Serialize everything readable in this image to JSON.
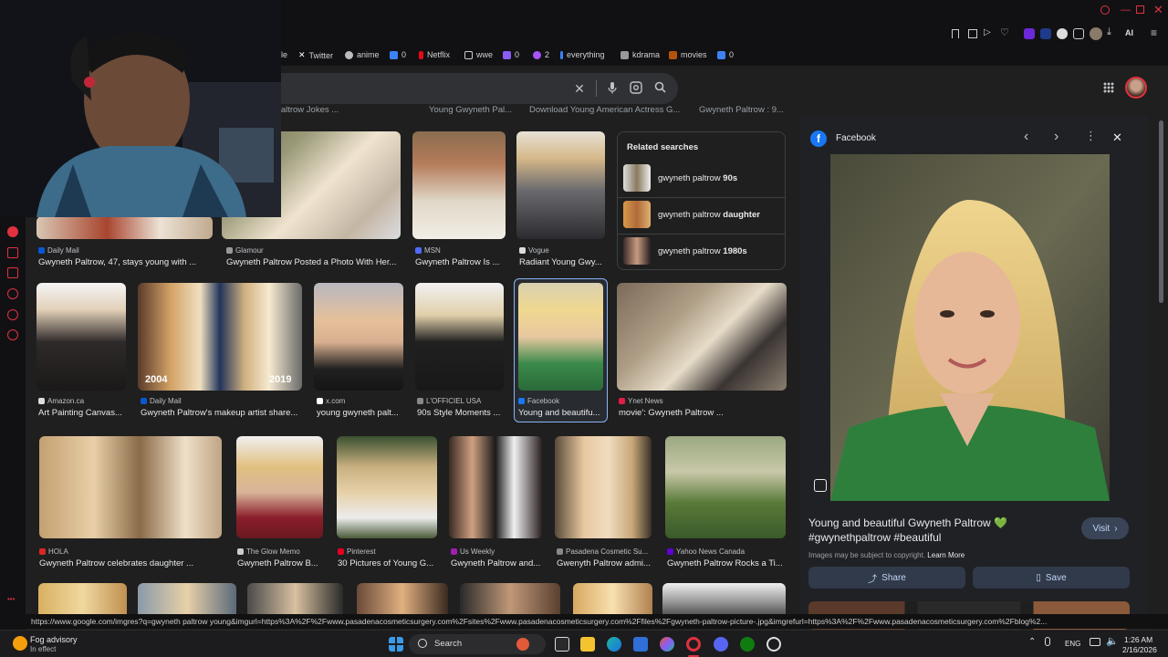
{
  "bookmarks": [
    {
      "label": "le",
      "color": "#888"
    },
    {
      "label": "Twitter",
      "color": "#ffffff"
    },
    {
      "label": "anime",
      "color": "#cccccc"
    },
    {
      "label": "0",
      "color": "#3b82f6"
    },
    {
      "label": "Netflix",
      "color": "#e50914"
    },
    {
      "label": "wwe",
      "color": "#cccccc"
    },
    {
      "label": "0",
      "color": "#8b5cf6"
    },
    {
      "label": "2",
      "color": "#a855f7"
    },
    {
      "label": "everything",
      "color": "#3b82f6"
    },
    {
      "label": "kdrama",
      "color": "#cccccc"
    },
    {
      "label": "movies",
      "color": "#b45309"
    },
    {
      "label": "0",
      "color": "#3b82f6"
    }
  ],
  "top_row_titles": [
    "...th Paltrow Jokes ...",
    "Young Gwyneth Pal...",
    "Download Young American Actress G...",
    "Gwyneth Paltrow : 9..."
  ],
  "row1": [
    {
      "source": "Daily Mail",
      "title": "Gwyneth Paltrow, 47, stays young with ...",
      "fav": "#0b57d0"
    },
    {
      "source": "Glamour",
      "title": "Gwyneth Paltrow Posted a Photo With Her...",
      "fav": "#999999"
    },
    {
      "source": "MSN",
      "title": "Gwyneth Paltrow Is ...",
      "fav": "#4d6bfe"
    },
    {
      "source": "Vogue",
      "title": "Radiant Young Gwy...",
      "fav": "#dddddd"
    }
  ],
  "related": {
    "heading": "Related searches",
    "items": [
      {
        "prefix": "gwyneth paltrow ",
        "bold": "90s"
      },
      {
        "prefix": "gwyneth paltrow ",
        "bold": "daughter"
      },
      {
        "prefix": "gwyneth paltrow ",
        "bold": "1980s"
      }
    ]
  },
  "row2": [
    {
      "source": "Amazon.ca",
      "title": "Art Painting Canvas...",
      "fav": "#dddddd"
    },
    {
      "source": "Daily Mail",
      "title": "Gwyneth Paltrow's makeup artist share...",
      "fav": "#0b57d0"
    },
    {
      "source": "x.com",
      "title": "young gwyneth palt...",
      "fav": "#ffffff"
    },
    {
      "source": "L'OFFICIEL USA",
      "title": "90s Style Moments ...",
      "fav": "#888888"
    },
    {
      "source": "Facebook",
      "title": "Young and beautifu...",
      "fav": "#1877f2"
    },
    {
      "source": "Ynet News",
      "title": "movie': Gwyneth Paltrow ...",
      "fav": "#e11d48"
    }
  ],
  "row2_years": [
    "2004",
    "2019"
  ],
  "row3": [
    {
      "source": "HOLA",
      "title": "Gwyneth Paltrow celebrates daughter ...",
      "fav": "#dc2626"
    },
    {
      "source": "The Glow Memo",
      "title": "Gwyneth Paltrow B...",
      "fav": "#cccccc"
    },
    {
      "source": "Pinterest",
      "title": "30 Pictures of Young G...",
      "fav": "#e60023"
    },
    {
      "source": "Us Weekly",
      "title": "Gwyneth Paltrow and...",
      "fav": "#a21caf"
    },
    {
      "source": "Pasadena Cosmetic Su...",
      "title": "Gwenyth Paltrow admi...",
      "fav": "#888888"
    },
    {
      "source": "Yahoo News Canada",
      "title": "Gwyneth Paltrow Rocks a Ti...",
      "fav": "#6001d2"
    }
  ],
  "preview": {
    "source": "Facebook",
    "title_line1": "Young and beautiful Gwyneth Paltrow 💚",
    "title_line2": "#gwynethpaltrow #beautiful",
    "copyright": "Images may be subject to copyright.",
    "learn_more": "Learn More",
    "visit": "Visit",
    "share": "Share",
    "save": "Save"
  },
  "status_url": "https://www.google.com/imgres?q=gwyneth paltrow young&imgurl=https%3A%2F%2Fwww.pasadenacosmeticsurgery.com%2Fsites%2Fwww.pasadenacosmeticsurgery.com%2Ffiles%2Fgwyneth-paltrow-picture-.jpg&imgrefurl=https%3A%2F%2Fwww.pasadenacosmeticsurgery.com%2Fblog%2...",
  "taskbar": {
    "weather_title": "Fog advisory",
    "weather_sub": "In effect",
    "search": "Search",
    "lang": "ENG",
    "time": "1:26 AM",
    "date": "2/16/2026"
  },
  "toolbar_ai": "AI"
}
